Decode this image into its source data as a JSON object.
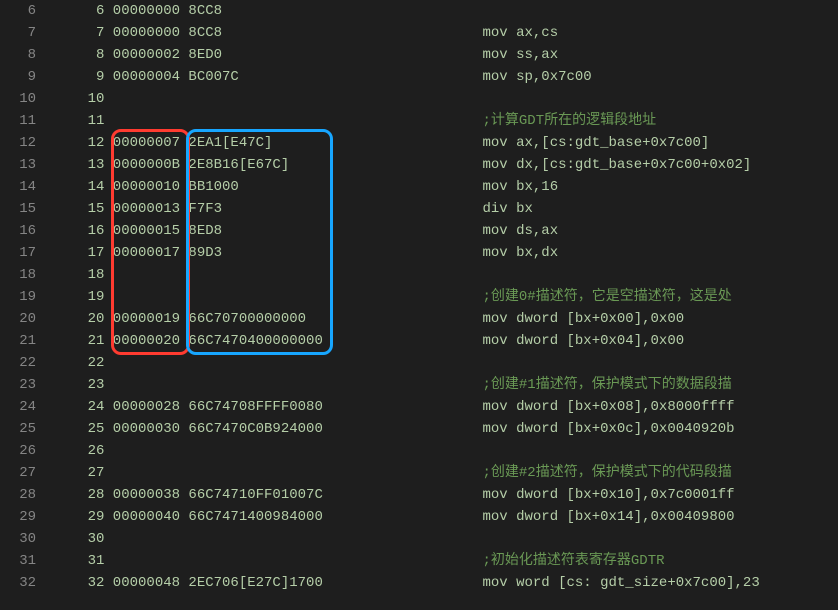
{
  "lines": [
    {
      "ln": 6,
      "left": "     6 00000000 8CC8",
      "right": ""
    },
    {
      "ln": 7,
      "left": "     7 00000000 8CC8",
      "right": "mov ax,cs"
    },
    {
      "ln": 8,
      "left": "     8 00000002 8ED0",
      "right": "mov ss,ax"
    },
    {
      "ln": 9,
      "left": "     9 00000004 BC007C",
      "right": "mov sp,0x7c00"
    },
    {
      "ln": 10,
      "left": "    10",
      "right": ""
    },
    {
      "ln": 11,
      "left": "    11",
      "right": ";计算GDT所在的逻辑段地址"
    },
    {
      "ln": 12,
      "left": "    12 00000007 2EA1[E47C]",
      "right": "mov ax,[cs:gdt_base+0x7c00]"
    },
    {
      "ln": 13,
      "left": "    13 0000000B 2E8B16[E67C]",
      "right": "mov dx,[cs:gdt_base+0x7c00+0x02]"
    },
    {
      "ln": 14,
      "left": "    14 00000010 BB1000",
      "right": "mov bx,16"
    },
    {
      "ln": 15,
      "left": "    15 00000013 F7F3",
      "right": "div bx"
    },
    {
      "ln": 16,
      "left": "    16 00000015 8ED8",
      "right": "mov ds,ax"
    },
    {
      "ln": 17,
      "left": "    17 00000017 89D3",
      "right": "mov bx,dx"
    },
    {
      "ln": 18,
      "left": "    18",
      "right": ""
    },
    {
      "ln": 19,
      "left": "    19",
      "right": ";创建0#描述符，它是空描述符，这是处"
    },
    {
      "ln": 20,
      "left": "    20 00000019 66C70700000000",
      "right": "mov dword [bx+0x00],0x00"
    },
    {
      "ln": 21,
      "left": "    21 00000020 66C7470400000000",
      "right": "mov dword [bx+0x04],0x00"
    },
    {
      "ln": 22,
      "left": "    22",
      "right": ""
    },
    {
      "ln": 23,
      "left": "    23",
      "right": ";创建#1描述符，保护模式下的数据段描"
    },
    {
      "ln": 24,
      "left": "    24 00000028 66C74708FFFF0080",
      "right": "mov dword [bx+0x08],0x8000ffff"
    },
    {
      "ln": 25,
      "left": "    25 00000030 66C7470C0B924000",
      "right": "mov dword [bx+0x0c],0x0040920b"
    },
    {
      "ln": 26,
      "left": "    26",
      "right": ""
    },
    {
      "ln": 27,
      "left": "    27",
      "right": ";创建#2描述符，保护模式下的代码段描"
    },
    {
      "ln": 28,
      "left": "    28 00000038 66C74710FF01007C",
      "right": "mov dword [bx+0x10],0x7c0001ff"
    },
    {
      "ln": 29,
      "left": "    29 00000040 66C7471400984000",
      "right": "mov dword [bx+0x14],0x00409800"
    },
    {
      "ln": 30,
      "left": "    30",
      "right": ""
    },
    {
      "ln": 31,
      "left": "    31",
      "right": ";初始化描述符表寄存器GDTR"
    },
    {
      "ln": 32,
      "left": "    32 00000048 2EC706[E27C]1700",
      "right": "mov word [cs: gdt_size+0x7c00],23"
    }
  ],
  "highlight": {
    "red": {
      "topLine": 12,
      "bottomLine": 21,
      "leftCh": 7,
      "rightCh": 16
    },
    "blue": {
      "topLine": 12,
      "bottomLine": 21,
      "leftCh": 16,
      "rightCh": 33
    }
  },
  "metrics": {
    "lineHeight": 22,
    "charWidth": 8.4,
    "codeLeftPad": 0,
    "rightColStart": 430
  }
}
